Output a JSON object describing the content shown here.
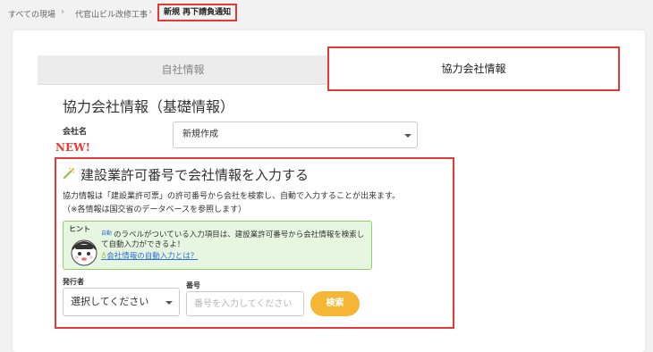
{
  "breadcrumb": {
    "items": [
      "すべての現場",
      "代官山ビル改修工事"
    ],
    "current": "新規 再下請負通知",
    "separator": "›"
  },
  "tabs": [
    {
      "label": "自社情報",
      "active": false
    },
    {
      "label": "協力会社情報",
      "active": true
    }
  ],
  "section": {
    "title": "協力会社情報（基礎情報）",
    "company_label": "会社名",
    "company_value": "新規作成"
  },
  "new_badge": "NEW!",
  "license_search": {
    "title": "建設業許可番号で会社情報を入力する",
    "description": "協力情報は「建設業許可票」の許可番号から会社を検索し、自動で入力することが出来ます。",
    "note": "（※各情報は国交省のデータベースを参照します）",
    "hint": {
      "label": "ヒント",
      "badge": "自動",
      "text": "のラベルがついている入力項目は、建設業許可番号から会社情報を検索して自動入力ができるよ！",
      "link": "会社情報の自動入力とは？"
    },
    "issuer_label": "発行者",
    "issuer_value": "選択してください",
    "number_label": "番号",
    "number_placeholder": "番号を入力してください",
    "search_button": "検索"
  },
  "colors": {
    "highlight": "#e53935",
    "search_button": "#f5b635",
    "hint_bg": "#e6f6e1",
    "hint_border": "#8fd06b",
    "link": "#2e6fd6"
  }
}
